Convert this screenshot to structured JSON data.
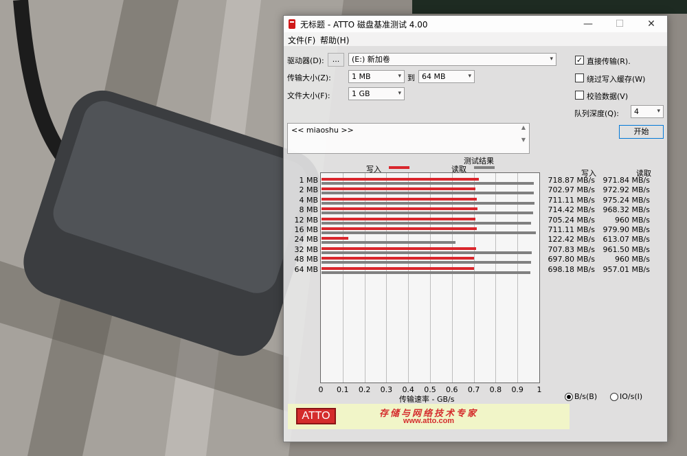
{
  "window": {
    "title": "无标题 - ATTO 磁盘基准测试 4.00",
    "min_icon": "minimize-icon",
    "max_icon": "maximize-icon",
    "close_icon": "close-icon",
    "min_glyph": "—",
    "max_glyph": "☐",
    "close_glyph": "✕"
  },
  "menu": [
    "文件(F)",
    "帮助(H)"
  ],
  "settings": {
    "drive_label": "驱动器(D):",
    "browse_label": "...",
    "drive_value": "(E:) 新加卷",
    "transfer_label": "传输大小(Z):",
    "transfer_from": "1 MB",
    "to_label": "到",
    "transfer_to": "64 MB",
    "file_label": "文件大小(F):",
    "file_value": "1 GB",
    "direct_io_label": "直接传输(R).",
    "direct_io_checked": true,
    "bypass_cache_label": "绕过写入缓存(W)",
    "bypass_cache_checked": false,
    "verify_label": "校验数据(V)",
    "verify_checked": false,
    "queue_label": "队列深度(Q):",
    "queue_value": "4",
    "start_label": "开始",
    "description": "<< miaoshu >>",
    "check_glyph": "✓",
    "arrow_glyph": "▾"
  },
  "results": {
    "title": "测试结果",
    "write_legend": "写入",
    "read_legend": "读取",
    "write_header": "写入",
    "read_header": "读取",
    "write_color": "#d9262c",
    "read_color": "#808080",
    "xlabel": "传输速率 - GB/s",
    "unit_bs_label": "B/s(B)",
    "unit_io_label": "IO/s(I)",
    "unit_selected": "B/s"
  },
  "chart_data": {
    "type": "bar",
    "orientation": "horizontal",
    "categories": [
      "1 MB",
      "2 MB",
      "4 MB",
      "8 MB",
      "12 MB",
      "16 MB",
      "24 MB",
      "32 MB",
      "48 MB",
      "64 MB"
    ],
    "series": [
      {
        "name": "写入",
        "values": [
          0.719,
          0.703,
          0.711,
          0.714,
          0.705,
          0.711,
          0.122,
          0.708,
          0.698,
          0.698
        ]
      },
      {
        "name": "读取",
        "values": [
          0.972,
          0.973,
          0.975,
          0.968,
          0.96,
          0.98,
          0.613,
          0.962,
          0.96,
          0.957
        ]
      }
    ],
    "xlim": [
      0,
      1
    ],
    "xticks": [
      "0",
      "0.1",
      "0.2",
      "0.3",
      "0.4",
      "0.5",
      "0.6",
      "0.7",
      "0.8",
      "0.9",
      "1"
    ],
    "xlabel": "传输速率 - GB/s",
    "grid": true,
    "legend": "top"
  },
  "table": {
    "write": [
      "718.87 MB/s",
      "702.97 MB/s",
      "711.11 MB/s",
      "714.42 MB/s",
      "705.24 MB/s",
      "711.11 MB/s",
      "122.42 MB/s",
      "707.83 MB/s",
      "697.80 MB/s",
      "698.18 MB/s"
    ],
    "read": [
      "971.84 MB/s",
      "972.92 MB/s",
      "975.24 MB/s",
      "968.32 MB/s",
      "960 MB/s",
      "979.90 MB/s",
      "613.07 MB/s",
      "961.50 MB/s",
      "960 MB/s",
      "957.01 MB/s"
    ]
  },
  "banner": {
    "logo": "ATTO",
    "slogan": "存储与网络技术专家",
    "url": "www.atto.com"
  }
}
